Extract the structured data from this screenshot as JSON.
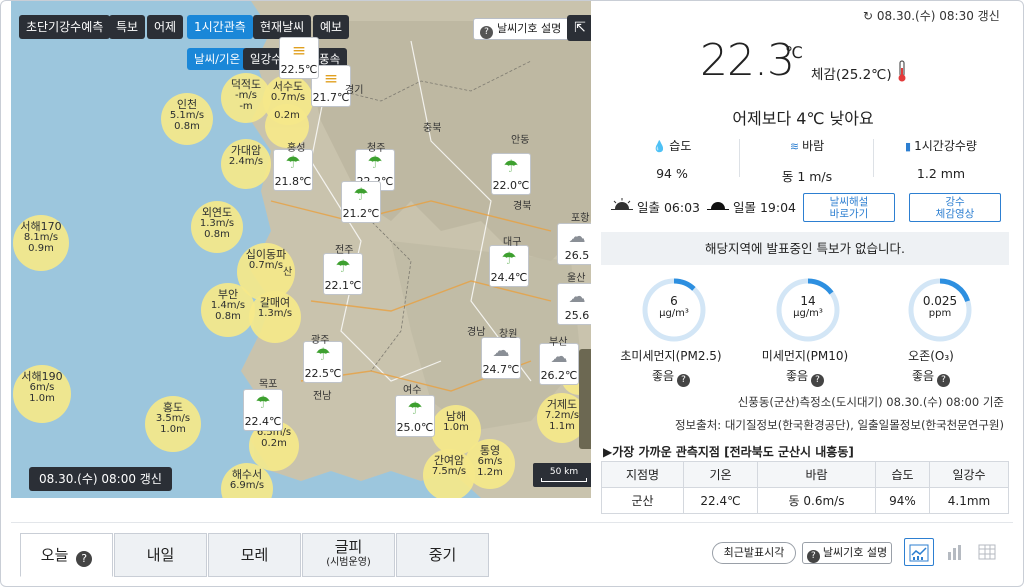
{
  "map": {
    "tabs_row1": [
      "초단기강수예측",
      "특보",
      "어제",
      "1시간관측",
      "현재날씨",
      "예보"
    ],
    "tabs_row2": [
      "날씨/기온",
      "일강수",
      "풍향/풍속"
    ],
    "legend_button": "날씨기호 설명",
    "timestamp": "08.30.(수) 08:00 갱신",
    "scale_label": "50 km",
    "bubbles": [
      {
        "name": "인천",
        "v1": "5.1m/s",
        "v2": "0.8m"
      },
      {
        "name": "덕적도",
        "v1": "-m/s",
        "v2": "-m"
      },
      {
        "name": "서수도",
        "v1": "0.7m/s",
        "v2": ""
      },
      {
        "name": "",
        "v1": "0.2m",
        "v2": ""
      },
      {
        "name": "가대암",
        "v1": "2.4m/s",
        "v2": ""
      },
      {
        "name": "외연도",
        "v1": "1.3m/s",
        "v2": "0.8m"
      },
      {
        "name": "서해170",
        "v1": "8.1m/s",
        "v2": "0.9m"
      },
      {
        "name": "십이동파",
        "v1": "0.7m/s",
        "v2": ""
      },
      {
        "name": "부안",
        "v1": "1.4m/s",
        "v2": "0.8m"
      },
      {
        "name": "갈매여",
        "v1": "1.3m/s",
        "v2": ""
      },
      {
        "name": "서해190",
        "v1": "6m/s",
        "v2": "1.0m"
      },
      {
        "name": "홍도",
        "v1": "3.5m/s",
        "v2": "1.0m"
      },
      {
        "name": "",
        "v1": "6.5m/s",
        "v2": "0.2m"
      },
      {
        "name": "해수서",
        "v1": "6.9m/s",
        "v2": ""
      },
      {
        "name": "남해",
        "v1": "1.0m",
        "v2": ""
      },
      {
        "name": "간여암",
        "v1": "7.5m/s",
        "v2": ""
      },
      {
        "name": "통영",
        "v1": "6m/s",
        "v2": "1.2m"
      },
      {
        "name": "거제도",
        "v1": "7.2m/s",
        "v2": "1.1m"
      },
      {
        "name": "",
        "v1": "8.8m/s",
        "v2": ""
      }
    ],
    "cards": [
      {
        "t": "21.7℃",
        "icon": "hazy-icon"
      },
      {
        "t": "22.5℃",
        "icon": "hazy-icon"
      },
      {
        "t": "21.8℃",
        "icon": "umbrella-icon"
      },
      {
        "t": "22.2℃",
        "icon": "umbrella-icon"
      },
      {
        "t": "21.2℃",
        "icon": "umbrella-icon"
      },
      {
        "t": "22.0℃",
        "icon": "umbrella-icon"
      },
      {
        "t": "22.1℃",
        "icon": "umbrella-icon"
      },
      {
        "t": "24.4℃",
        "icon": "umbrella-icon"
      },
      {
        "t": "22.5℃",
        "icon": "umbrella-icon"
      },
      {
        "t": "24.7℃",
        "icon": "cloud-icon"
      },
      {
        "t": "26.2℃",
        "icon": "cloud-icon"
      },
      {
        "t": "22.4℃",
        "icon": "umbrella-icon"
      },
      {
        "t": "25.0℃",
        "icon": "umbrella-icon"
      },
      {
        "t": "26.5",
        "icon": "cloud-icon"
      },
      {
        "t": "25.6",
        "icon": "cloud-icon"
      }
    ],
    "cities": [
      "경기",
      "충북",
      "홍성",
      "청주",
      "안동",
      "경북",
      "포항",
      "전주",
      "대구",
      "울산",
      "광주",
      "경남",
      "창원",
      "부산",
      "전남",
      "목포",
      "여수",
      "산"
    ]
  },
  "current": {
    "updated": "08.30.(수) 08:30 갱신",
    "temp": "22.3",
    "unit": "℃",
    "feels": "체감(25.2℃)",
    "compare": "어제보다 4℃ 낮아요",
    "humidity_label": "습도",
    "humidity_value": "94 %",
    "wind_label": "바람",
    "wind_value": "동 1 m/s",
    "rain_label": "1시간강수량",
    "rain_value": "1.2 mm",
    "sunrise": "일출  06:03",
    "sunset": "일몰  19:04",
    "btn_weather_explain": "날씨해설\n바로가기",
    "btn_rain_video": "강수\n체감영상",
    "warning": "해당지역에 발표중인 특보가 없습니다."
  },
  "air": [
    {
      "value": "6",
      "unit": "μg/m³",
      "label": "초미세먼지(PM2.5)",
      "grade": "좋음",
      "fraction": 0.12
    },
    {
      "value": "14",
      "unit": "μg/m³",
      "label": "미세먼지(PM10)",
      "grade": "좋음",
      "fraction": 0.15
    },
    {
      "value": "0.025",
      "unit": "ppm",
      "label": "오존(O₃)",
      "grade": "좋음",
      "fraction": 0.2
    }
  ],
  "station": "신풍동(군산)측정소(도시대기) 08.30.(수) 08:00 기준",
  "source": "정보출처: 대기질정보(한국환경공단), 일출일몰정보(한국천문연구원)",
  "obs": {
    "title": "▶가장 가까운 관측지점 [전라북도 군산시 내흥동]",
    "headers": [
      "지점명",
      "기온",
      "바람",
      "습도",
      "일강수"
    ],
    "row": [
      "군산",
      "22.4℃",
      "동 0.6m/s",
      "94%",
      "4.1mm"
    ]
  },
  "bottom": {
    "tabs": [
      {
        "label": "오늘",
        "sub": ""
      },
      {
        "label": "내일",
        "sub": ""
      },
      {
        "label": "모레",
        "sub": ""
      },
      {
        "label": "글피",
        "sub": "(시범운영)"
      },
      {
        "label": "중기",
        "sub": ""
      }
    ],
    "recent_button": "최근발표시각",
    "legend_button": "날씨기호 설명"
  },
  "colors": {
    "accent": "#1a87d8",
    "dark": "#2b2f36",
    "gauge": "#2d8fe0"
  }
}
